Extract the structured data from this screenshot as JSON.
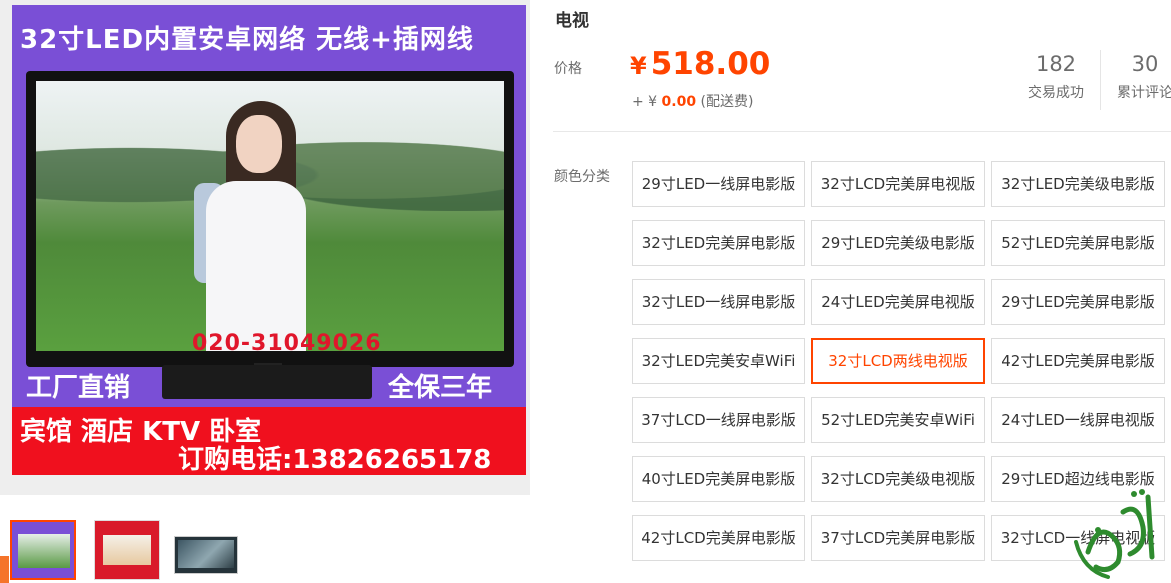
{
  "gallery": {
    "promo_top": "32寸LED内置安卓网络 无线+插网线",
    "promo_phone": "020-31049026",
    "promo_left": "工厂直销",
    "promo_right": "全保三年",
    "promo_red_line1": "宾馆 酒店 KTV 卧室",
    "promo_red_line2": "订购电话:13826265178"
  },
  "product": {
    "title": "电视",
    "price_label": "价格",
    "currency": "¥",
    "price": "518.00",
    "shipping_prefix": "+ ¥ ",
    "shipping_fee": "0.00",
    "shipping_note": "(配送费)"
  },
  "stats": [
    {
      "value": "182",
      "label": "交易成功"
    },
    {
      "value": "30",
      "label": "累计评论"
    }
  ],
  "options": {
    "label": "颜色分类",
    "selected_index": 10,
    "items": [
      "29寸LED一线屏电影版",
      "32寸LCD完美屏电视版",
      "32寸LED完美级电影版",
      "32寸LED完美屏电影版",
      "29寸LED完美级电影版",
      "52寸LED完美屏电影版",
      "32寸LED一线屏电影版",
      "24寸LED完美屏电视版",
      "29寸LED完美屏电影版",
      "32寸LED完美安卓WiFi",
      "32寸LCD两线电视版",
      "42寸LED完美屏电影版",
      "37寸LCD一线屏电影版",
      "52寸LED完美安卓WiFi",
      "24寸LED一线屏电视版",
      "40寸LED完美屏电影版",
      "32寸LCD完美级电视版",
      "29寸LED超边线电影版",
      "42寸LCD完美屏电影版",
      "37寸LCD完美屏电影版",
      "32寸LCD一线屏电视版"
    ]
  },
  "colors": {
    "accent": "#ff4400",
    "promo_purple": "#7a4fd6",
    "promo_red": "#f0101e"
  }
}
